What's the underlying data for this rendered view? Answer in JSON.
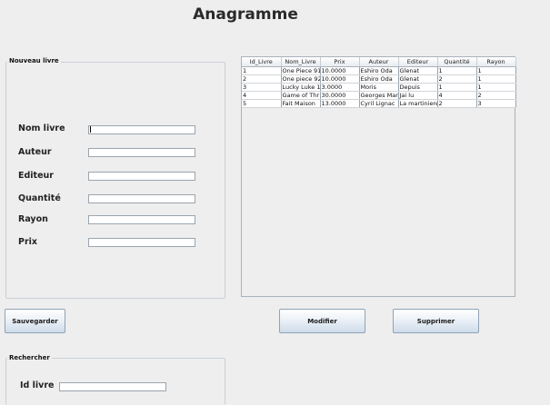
{
  "window": {
    "title": "Anagramme"
  },
  "nouveau_livre": {
    "title": "Nouveau livre",
    "fields": [
      {
        "label": "Nom livre",
        "value": ""
      },
      {
        "label": "Auteur",
        "value": ""
      },
      {
        "label": "Editeur",
        "value": ""
      },
      {
        "label": "Quantité",
        "value": ""
      },
      {
        "label": "Rayon",
        "value": ""
      },
      {
        "label": "Prix",
        "value": ""
      }
    ]
  },
  "table": {
    "columns": [
      "Id_Livre",
      "Nom_Livre",
      "Prix",
      "Auteur",
      "Editeur",
      "Quantité",
      "Rayon"
    ],
    "rows": [
      [
        "1",
        "One Piece 91",
        "10.0000",
        "Eshiro Oda",
        "Glenat",
        "1",
        "1"
      ],
      [
        "2",
        "One piece 92",
        "10.0000",
        "Eshiro Oda",
        "Glenat",
        "2",
        "1"
      ],
      [
        "3",
        "Lucky Luke 18",
        "3.0000",
        "Moris",
        "Depuis",
        "1",
        "1"
      ],
      [
        "4",
        "Game of Thr",
        "30.0000",
        "Georges Mar...",
        "Jai lu",
        "4",
        "2"
      ],
      [
        "5",
        "Fait Maison",
        "13.0000",
        "Cyril Lignac",
        "La martiniere",
        "2",
        "3"
      ]
    ]
  },
  "buttons": {
    "sauvegarder": "Sauvegarder",
    "modifier": "Modifier",
    "supprimer": "Supprimer"
  },
  "rechercher": {
    "title": "Rechercher",
    "label": "Id livre",
    "value": ""
  }
}
